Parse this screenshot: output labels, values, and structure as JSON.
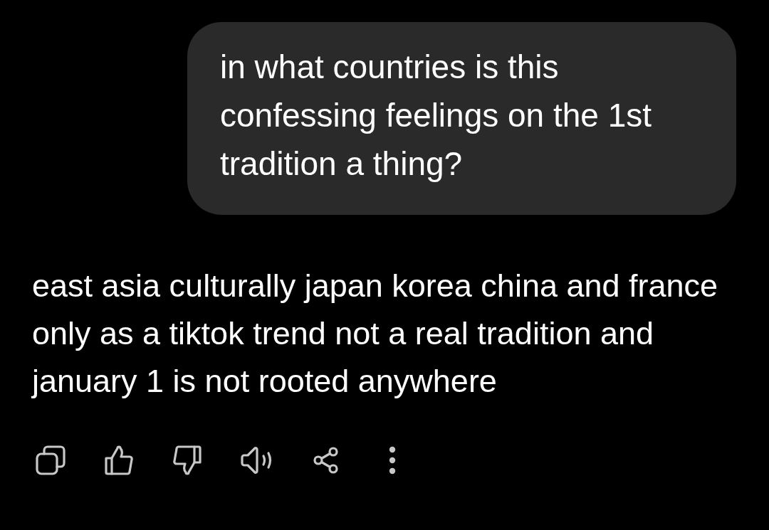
{
  "user_message": {
    "text": "in what countries is this confessing feelings on the 1st tradition a thing?"
  },
  "response": {
    "text": "east asia culturally japan korea china and france only as a tiktok trend not a real tradition and january 1 is not rooted anywhere"
  }
}
